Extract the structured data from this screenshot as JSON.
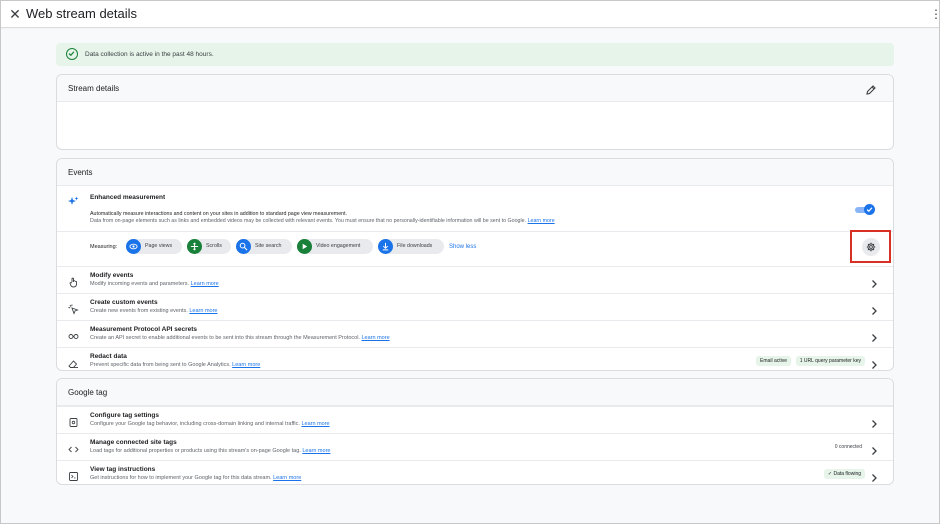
{
  "window": {
    "title": "Web stream details"
  },
  "banner": {
    "text": "Data collection is active in the past 48 hours."
  },
  "stream_details": {
    "title": "Stream details"
  },
  "events": {
    "title": "Events",
    "enhanced": {
      "title": "Enhanced measurement",
      "desc1": "Automatically measure interactions and content on your sites in addition to standard page view measurement.",
      "desc2": "Data from on-page elements such as links and embedded videos may be collected with relevant events. You must ensure that no personally-identifiable information will be sent to Google.",
      "learn_more": "Learn more",
      "measuring_label": "Measuring:",
      "chips": [
        {
          "label": "Page views",
          "color": "#1a73e8"
        },
        {
          "label": "Scrolls",
          "color": "#188038"
        },
        {
          "label": "Site search",
          "color": "#1a73e8"
        },
        {
          "label": "Video engagement",
          "color": "#188038"
        },
        {
          "label": "File downloads",
          "color": "#1a73e8"
        }
      ],
      "show_less": "Show less"
    },
    "rows": [
      {
        "title": "Modify events",
        "desc": "Modify incoming events and parameters.",
        "link": "Learn more"
      },
      {
        "title": "Create custom events",
        "desc": "Create new events from existing events.",
        "link": "Learn more"
      },
      {
        "title": "Measurement Protocol API secrets",
        "desc": "Create an API secret to enable additional events to be sent into this stream through the Measurement Protocol.",
        "link": "Learn more"
      },
      {
        "title": "Redact data",
        "desc": "Prevent specific data from being sent to Google Analytics.",
        "link": "Learn more",
        "badges": [
          "Email active",
          "1 URL query parameter key"
        ]
      }
    ]
  },
  "google_tag": {
    "title": "Google tag",
    "rows": [
      {
        "title": "Configure tag settings",
        "desc": "Configure your Google tag behavior, including cross-domain linking and internal traffic.",
        "link": "Learn more"
      },
      {
        "title": "Manage connected site tags",
        "desc": "Load tags for additional properties or products using this stream's on-page Google tag.",
        "link": "Learn more",
        "status": "0 connected"
      },
      {
        "title": "View tag instructions",
        "desc": "Get instructions for how to implement your Google tag for this data stream.",
        "link": "Learn more",
        "badge": "Data flowing"
      }
    ]
  }
}
